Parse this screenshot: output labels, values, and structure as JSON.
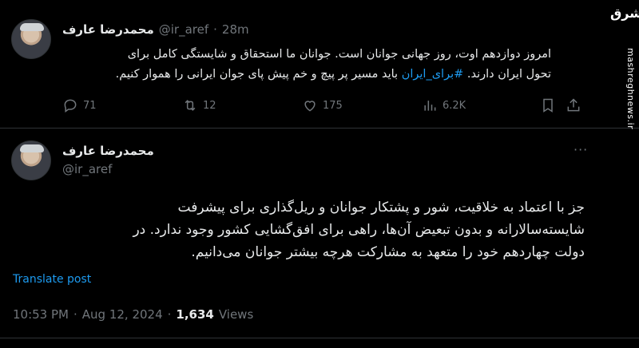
{
  "quoted_tweet": {
    "display_name": "محمدرضا عارف",
    "handle": "@ir_aref",
    "separator": "·",
    "time": "28m",
    "text_line1": "امروز دوازدهم اوت، روز جهانی جوانان است. جوانان ما استحقاق و شایستگی کامل برای",
    "text_line2_before": "تحول ایران دارند. ",
    "hashtag": "#برای_ایران",
    "text_line2_after": " باید مسیر پر پیچ و خم پیش پای جوان ایرانی را هموار کنیم.",
    "replies": "71",
    "reposts": "12",
    "likes": "175",
    "views": "6.2K"
  },
  "main_tweet": {
    "display_name": "محمدرضا عارف",
    "handle": "@ir_aref",
    "more": "···",
    "text_line1": "جز با اعتماد به خلاقیت، شور و پشتکار جوانان و ریل‌گذاری برای پیشرفت",
    "text_line2": "شایسته‌سالارانه و بدون تبعیض آن‌ها، راهی برای افق‌گشایی کشور وجود ندارد. در",
    "text_line3": "دولت چهاردهم خود را متعهد به مشارکت هرچه بیشتر جوانان می‌دانیم.",
    "translate": "Translate post",
    "time": "10:53 PM",
    "sep": "·",
    "date": "Aug 12, 2024",
    "sep2": "·",
    "views_count": "1,634",
    "views_label": "Views"
  },
  "watermark": {
    "logo": "مشرق",
    "url": "mashreghnews.ir"
  }
}
